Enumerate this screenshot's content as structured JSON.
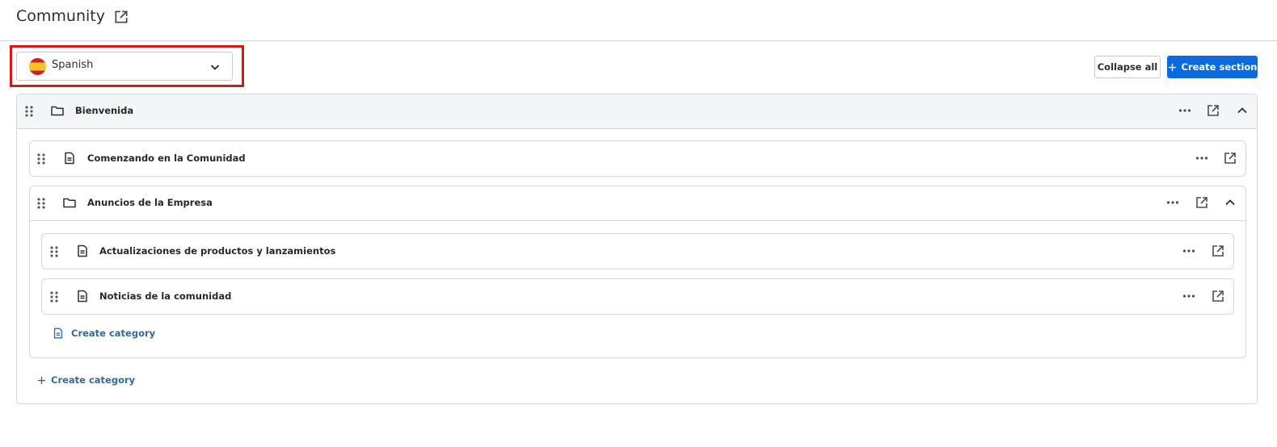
{
  "header": {
    "title": "Community",
    "external_link_icon": "external-link-icon"
  },
  "language_selector": {
    "selected": "Spanish",
    "flag": "spain-flag",
    "highlighted": true
  },
  "toolbar": {
    "collapse_all_label": "Collapse all",
    "create_section_label": "Create section"
  },
  "section": {
    "title": "Bienvenida",
    "icon": "folder-icon",
    "expanded": true,
    "items": [
      {
        "type": "article",
        "title": "Comenzando en la Comunidad",
        "icon": "document-icon"
      },
      {
        "type": "folder",
        "title": "Anuncios de la Empresa",
        "icon": "folder-icon",
        "expanded": true,
        "children": [
          {
            "type": "article",
            "title": "Actualizaciones de productos y lanzamientos",
            "icon": "document-icon"
          },
          {
            "type": "article",
            "title": "Noticias de la comunidad",
            "icon": "document-icon"
          }
        ],
        "create_label": "Create category"
      }
    ],
    "create_label": "Create category"
  }
}
